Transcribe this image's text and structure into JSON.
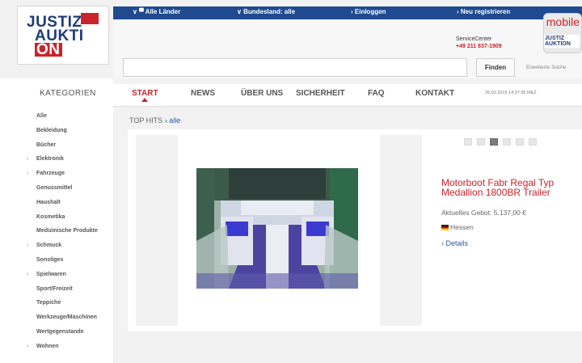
{
  "logo": {
    "line1": "JUSTIZ",
    "line2": "AUKTI",
    "on": "ON"
  },
  "topnav": {
    "countries": "∨ ▀ Alle Länder",
    "state": "∨ Bundesland: alle",
    "login": "› Einloggen",
    "register": "› Neu registrieren"
  },
  "service": {
    "label": "ServiceCenter",
    "phone": "+49 211 837-1909"
  },
  "mobile_badge": {
    "text": "mobile",
    "logo": "JUSTIZ AUKTION"
  },
  "search": {
    "value": "",
    "button": "Finden",
    "advanced": "Erweiterte Suche"
  },
  "sidebar": {
    "title": "KATEGORIEN",
    "items": [
      {
        "label": "Alle",
        "arrow": ""
      },
      {
        "label": "Bekleidung",
        "arrow": ""
      },
      {
        "label": "Bücher",
        "arrow": ""
      },
      {
        "label": "Elektronik",
        "arrow": "›"
      },
      {
        "label": "Fahrzeuge",
        "arrow": "›"
      },
      {
        "label": "Genussmittel",
        "arrow": ""
      },
      {
        "label": "Haushalt",
        "arrow": ""
      },
      {
        "label": "Kosmetika",
        "arrow": ""
      },
      {
        "label": "Medizinische Produkte",
        "arrow": ""
      },
      {
        "label": "Schmuck",
        "arrow": "›"
      },
      {
        "label": "Sonstiges",
        "arrow": ""
      },
      {
        "label": "Spielwaren",
        "arrow": "›"
      },
      {
        "label": "Sport/Freizeit",
        "arrow": ""
      },
      {
        "label": "Teppiche",
        "arrow": ""
      },
      {
        "label": "Werkzeuge/Maschinen",
        "arrow": ""
      },
      {
        "label": "Wertgegenstande",
        "arrow": ""
      },
      {
        "label": "Wohnen",
        "arrow": "›"
      }
    ]
  },
  "mainnav": {
    "items": [
      "START",
      "NEWS",
      "ÜBER UNS",
      "SICHERHEIT",
      "FAQ",
      "KONTAKT"
    ],
    "active": "START",
    "datetime": "26.02.2015 14:37:35 MEZ"
  },
  "tophits": {
    "label": "TOP HITS",
    "link": "› alle"
  },
  "listing": {
    "title": "Motorboot Fabr Regal Typ Medallion 1800BR Trailer",
    "price": "Aktuelles Gebot: 5.137,00 €",
    "region": "Hessen",
    "details": "› Details",
    "dots": [
      false,
      false,
      true,
      false,
      false,
      false
    ]
  },
  "colors": {
    "brand_blue": "#1f4a8f",
    "accent_red": "#c9242b",
    "link_blue": "#2a5aa8"
  }
}
